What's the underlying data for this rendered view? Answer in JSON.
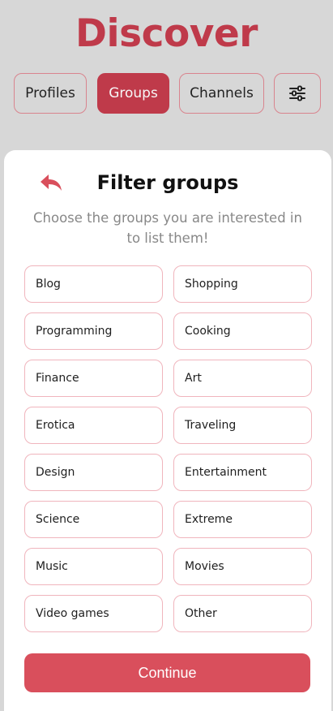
{
  "header": {
    "title": "Discover"
  },
  "tabs": [
    {
      "label": "Profiles",
      "active": false
    },
    {
      "label": "Groups",
      "active": true
    },
    {
      "label": "Channels",
      "active": false
    }
  ],
  "filter_icon": "sliders-icon",
  "sheet": {
    "back_icon": "reply-arrow-icon",
    "title": "Filter groups",
    "subtitle": "Choose the groups you are interested in to list them!",
    "categories": [
      "Blog",
      "Shopping",
      "Programming",
      "Cooking",
      "Finance",
      "Art",
      "Erotica",
      "Traveling",
      "Design",
      "Entertainment",
      "Science",
      "Extreme",
      "Music",
      "Movies",
      "Video games",
      "Other"
    ],
    "continue_label": "Continue"
  },
  "colors": {
    "brand": "#bf3a4a",
    "button": "#d94f5c",
    "chip_border": "#f0b5bd",
    "backdrop": "#d7d7d7"
  }
}
